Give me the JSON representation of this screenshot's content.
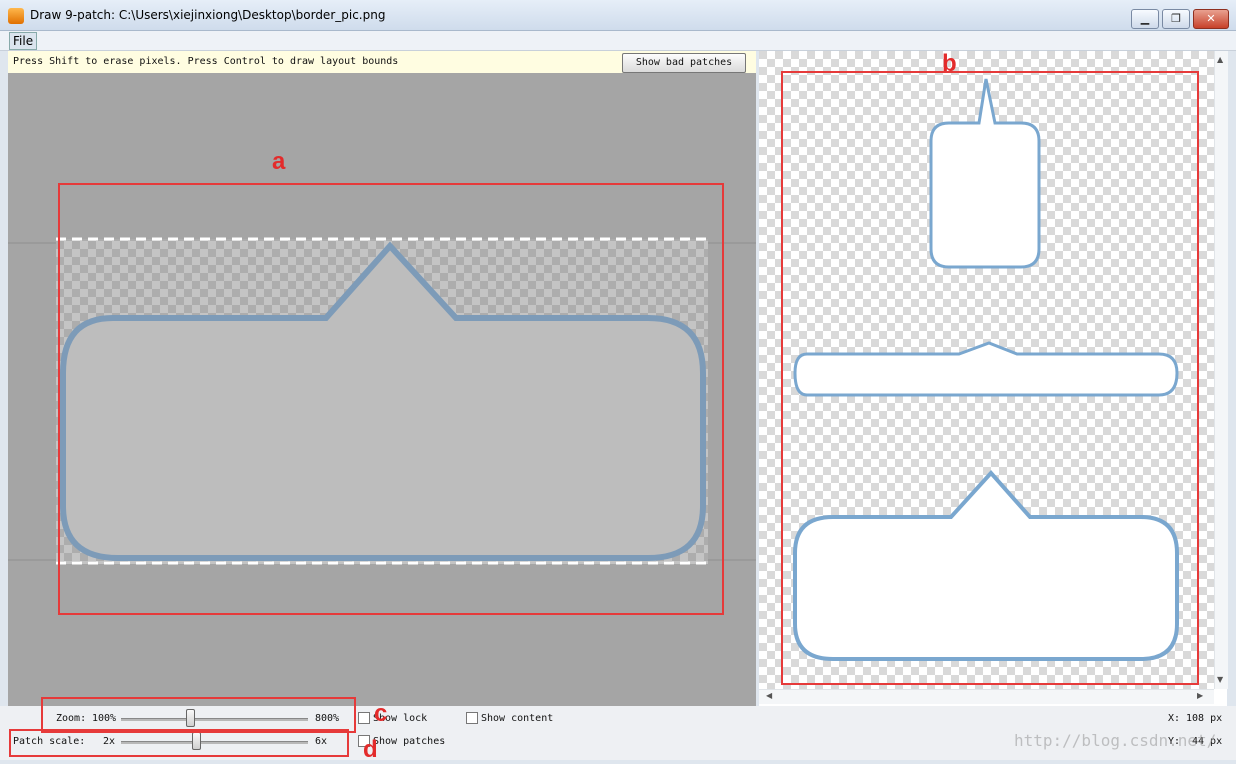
{
  "window": {
    "title": "Draw 9-patch: C:\\Users\\xiejinxiong\\Desktop\\border_pic.png",
    "min_label": "▁",
    "max_label": "❐",
    "close_label": "✕"
  },
  "menu": {
    "file_label": "File"
  },
  "editor": {
    "hint": "Press Shift to erase pixels. Press Control to draw layout bounds",
    "bad_patches_label": "Show bad patches"
  },
  "annotations": {
    "a": "a",
    "b": "b",
    "c": "c",
    "d": "d"
  },
  "controls": {
    "zoom_label": "Zoom:",
    "zoom_min": "100%",
    "zoom_max": "800%",
    "zoom_value_fraction": 0.37,
    "patch_scale_label": "Patch scale:",
    "patch_min": "2x",
    "patch_max": "6x",
    "patch_value_fraction": 0.4,
    "show_lock": "Show lock",
    "show_patches": "Show patches",
    "show_content": "Show content",
    "x_label": "X:",
    "x_value": "108 px",
    "y_label": "Y:",
    "y_value": "44 px"
  },
  "watermark": "http://blog.csdn.net/",
  "colors": {
    "annotation": "#e63a3a",
    "outline": "#7aa7cf",
    "editor_bg": "#a5a5a5"
  },
  "icons": {
    "scroll_up": "▲",
    "scroll_down": "▼",
    "scroll_left": "◀",
    "scroll_right": "▶"
  }
}
